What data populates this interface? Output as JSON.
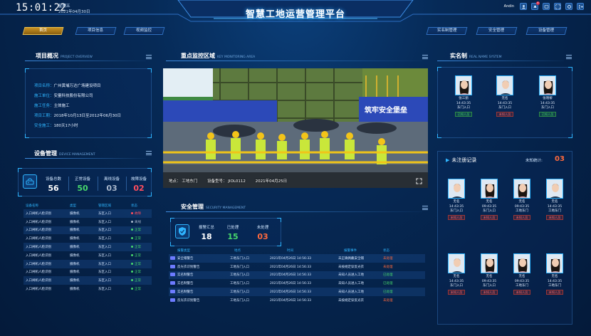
{
  "header": {
    "time": "15:01:22",
    "weekday": "星期五",
    "date": "2021年04月30日",
    "title": "智慧工地运营管理平台",
    "username": "Andin",
    "notif_count": "8"
  },
  "nav_left": [
    {
      "label": "首页",
      "active": true
    },
    {
      "label": "项目信息"
    },
    {
      "label": "视频监控"
    }
  ],
  "nav_right": [
    {
      "label": "实名制管理"
    },
    {
      "label": "安全管理"
    },
    {
      "label": "设备管理"
    }
  ],
  "project": {
    "title": "项目概况",
    "subtitle": "PROJECT OVERVIEW",
    "rows": [
      {
        "k": "项目名称：",
        "v": "广州黄埔万达广场建设项目"
      },
      {
        "k": "施工单位：",
        "v": "安量科技股份有限公司"
      },
      {
        "k": "施工任务：",
        "v": "主体施工"
      },
      {
        "k": "项目工期：",
        "v": "2018年10月13日至2012年06月30日"
      },
      {
        "k": "安全施工：",
        "v": "180天17小时"
      }
    ]
  },
  "device": {
    "title": "设备管理",
    "subtitle": "DEVICE MANAGEMENT",
    "stats": [
      {
        "label": "设备总数",
        "value": "56",
        "color": "#ffffff"
      },
      {
        "label": "正常设备",
        "value": "50",
        "color": "#47d86c"
      },
      {
        "label": "离线设备",
        "value": "03",
        "color": "#a9b8cc"
      },
      {
        "label": "故障设备",
        "value": "02",
        "color": "#ff4d5e"
      }
    ],
    "headers": [
      "设备名称",
      "类型",
      "管辖区域",
      "状态"
    ],
    "rows": [
      {
        "name": "入口闸机人脸识别",
        "type": "摄像机",
        "area": "东区入口",
        "status": "故障",
        "color": "#ff4d5e"
      },
      {
        "name": "入口闸机人脸识别",
        "type": "摄像机",
        "area": "东区入口",
        "status": "离线",
        "color": "#a9b8cc"
      },
      {
        "name": "入口闸机人脸识别",
        "type": "摄像机",
        "area": "东区入口",
        "status": "正常",
        "color": "#47d86c"
      },
      {
        "name": "入口闸机人脸识别",
        "type": "摄像机",
        "area": "东区入口",
        "status": "正常",
        "color": "#47d86c"
      },
      {
        "name": "入口闸机人脸识别",
        "type": "摄像机",
        "area": "东区入口",
        "status": "正常",
        "color": "#47d86c"
      },
      {
        "name": "入口闸机人脸识别",
        "type": "摄像机",
        "area": "东区入口",
        "status": "正常",
        "color": "#47d86c"
      },
      {
        "name": "入口闸机人脸识别",
        "type": "摄像机",
        "area": "东区入口",
        "status": "正常",
        "color": "#47d86c"
      },
      {
        "name": "入口闸机人脸识别",
        "type": "摄像机",
        "area": "东区入口",
        "status": "正常",
        "color": "#47d86c"
      },
      {
        "name": "入口闸机人脸识别",
        "type": "摄像机",
        "area": "东区入口",
        "status": "正常",
        "color": "#47d86c"
      },
      {
        "name": "入口闸机人脸识别",
        "type": "摄像机",
        "area": "东区入口",
        "status": "正常",
        "color": "#47d86c"
      }
    ]
  },
  "monitor": {
    "title": "重点监控区域",
    "subtitle": "KEY MONITORING AREA",
    "caption_location": "地点：  工地东门",
    "caption_device": "设备型号：  JIOL0112",
    "caption_date": "2021年04月25日",
    "banner_text": "筑牢安全堡垒"
  },
  "security": {
    "title": "安全管理",
    "subtitle": "SECURITY MANAGEMENT",
    "stats": [
      {
        "label": "报警汇总",
        "value": "18",
        "color": "#ffffff"
      },
      {
        "label": "已处理",
        "value": "15",
        "color": "#47d86c"
      },
      {
        "label": "未处理",
        "value": "03",
        "color": "#ff6a3d"
      }
    ],
    "headers": [
      "报警类型",
      "地点",
      "时间",
      "报警事件",
      "状态"
    ],
    "rows": [
      {
        "type": "安全帽警告",
        "loc": "工地东门入口",
        "time": "2021年04月26日 14:56:33",
        "event": "未正确佩戴安全帽",
        "status": "未处理",
        "color": "#ff6a3d"
      },
      {
        "type": "反光衣识别警告",
        "loc": "工地东门入口",
        "time": "2021年04月26日 14:56:33",
        "event": "未按规定穿反光衣",
        "status": "未处理",
        "color": "#ff6a3d"
      },
      {
        "type": "实名制警告",
        "loc": "工地东门入口",
        "time": "2021年04月26日 14:56:33",
        "event": "未知人员进入工地",
        "status": "已处理",
        "color": "#47d86c"
      },
      {
        "type": "实名制警告",
        "loc": "工地东门入口",
        "time": "2021年04月26日 14:56:33",
        "event": "未知人员进入工地",
        "status": "已处理",
        "color": "#47d86c"
      },
      {
        "type": "实名制警告",
        "loc": "工地东门入口",
        "time": "2021年04月26日 14:56:33",
        "event": "未知人员进入工地",
        "status": "已处理",
        "color": "#47d86c"
      },
      {
        "type": "反光衣识别警告",
        "loc": "工地东门入口",
        "time": "2021年04月26日 14:56:33",
        "event": "未按规定穿反光衣",
        "status": "未处理",
        "color": "#ff6a3d"
      }
    ]
  },
  "realname": {
    "title": "实名制",
    "subtitle": "REAL NAME SYSTEM",
    "people": [
      {
        "name": "张三丽",
        "time": "14:43:35",
        "place": "东门入口",
        "tag": "已知人员",
        "known": true,
        "sex": "f"
      },
      {
        "name": "无名",
        "time": "14:43:35",
        "place": "东门入口",
        "tag": "未知人员",
        "known": false,
        "sex": "m"
      },
      {
        "name": "张晓黎",
        "time": "14:43:35",
        "place": "东门入口",
        "tag": "已知人员",
        "known": true,
        "sex": "f"
      }
    ]
  },
  "unregistered": {
    "title": "未注册记录",
    "count_label": "未知统计:",
    "count": "03",
    "people": [
      {
        "name": "无名",
        "time": "14:43:35",
        "place": "东门入口",
        "tag": "未知人员",
        "sex": "m"
      },
      {
        "name": "无名",
        "time": "09:43:35",
        "place": "东门入口",
        "tag": "未知人员",
        "sex": "f"
      },
      {
        "name": "无名",
        "time": "09:43:35",
        "place": "工地东门",
        "tag": "未知人员",
        "sex": "f"
      },
      {
        "name": "无名",
        "time": "14:43:35",
        "place": "工地东门",
        "tag": "未知人员",
        "sex": "m"
      },
      {
        "name": "无名",
        "time": "14:43:35",
        "place": "东门入口",
        "tag": "未知人员",
        "sex": "m"
      },
      {
        "name": "无名",
        "time": "09:43:35",
        "place": "东门入口",
        "tag": "未知人员",
        "sex": "f"
      },
      {
        "name": "无名",
        "time": "09:43:35",
        "place": "工地东门",
        "tag": "未知人员",
        "sex": "f"
      },
      {
        "name": "无名",
        "time": "14:43:35",
        "place": "工地东门",
        "tag": "未知人员",
        "sex": "f"
      }
    ]
  }
}
